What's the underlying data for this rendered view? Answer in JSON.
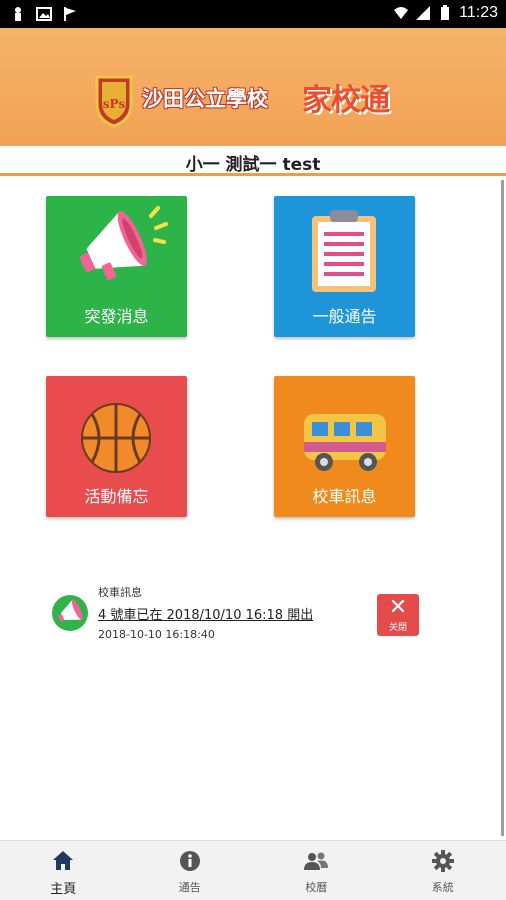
{
  "status_bar": {
    "time": "11:23"
  },
  "header": {
    "logo_text": "sPs",
    "school_name": "沙田公立學校",
    "app_name": "家校通"
  },
  "user": {
    "name": "小一 測試一 test"
  },
  "tiles": [
    {
      "label": "突發消息",
      "color": "#2db449",
      "icon": "megaphone-icon"
    },
    {
      "label": "一般通告",
      "color": "#1e95d9",
      "icon": "clipboard-icon"
    },
    {
      "label": "活動備忘",
      "color": "#e84c4c",
      "icon": "basketball-icon"
    },
    {
      "label": "校車訊息",
      "color": "#f08a1d",
      "icon": "bus-icon"
    }
  ],
  "notification": {
    "category": "校車訊息",
    "message": "4 號車已在 2018/10/10 16:18 開出",
    "timestamp": "2018-10-10 16:18:40",
    "close_label": "关閉"
  },
  "tabbar": [
    {
      "label": "主頁",
      "icon": "home-icon",
      "active": true
    },
    {
      "label": "通告",
      "icon": "info-icon",
      "active": false
    },
    {
      "label": "校曆",
      "icon": "people-icon",
      "active": false
    },
    {
      "label": "系統",
      "icon": "gear-icon",
      "active": false
    }
  ]
}
